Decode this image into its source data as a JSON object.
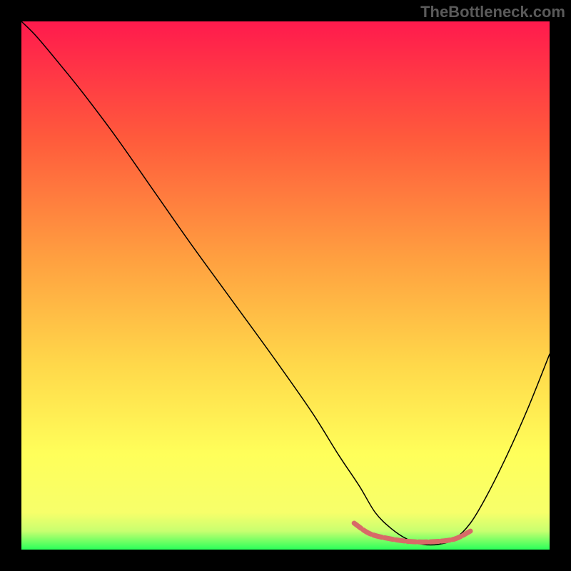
{
  "watermark": "TheBottleneck.com",
  "chart_data": {
    "type": "line",
    "title": "",
    "xlabel": "",
    "ylabel": "",
    "xlim": [
      0,
      100
    ],
    "ylim": [
      0,
      100
    ],
    "grid": false,
    "series": [
      {
        "name": "curve",
        "color": "#000000",
        "stroke_width": 1.5,
        "x": [
          0,
          3,
          8,
          12,
          18,
          25,
          32,
          40,
          48,
          55,
          60,
          64,
          67,
          70,
          73,
          76,
          79,
          82,
          85,
          88,
          92,
          96,
          100
        ],
        "y": [
          100,
          97,
          91,
          86,
          78,
          68,
          58,
          47,
          36,
          26,
          18,
          12,
          7,
          4,
          2,
          1,
          1,
          2,
          5,
          10,
          18,
          27,
          37
        ]
      },
      {
        "name": "highlight-band",
        "color": "#d86a68",
        "stroke_width": 7,
        "dash": "12,4",
        "x": [
          63,
          66,
          70,
          74,
          78,
          82,
          85
        ],
        "y": [
          5,
          3,
          2,
          1.5,
          1.5,
          2,
          3.5
        ]
      }
    ],
    "background_gradient": {
      "type": "vertical",
      "stops": [
        {
          "offset": 0.0,
          "color": "#ff1a4d"
        },
        {
          "offset": 0.22,
          "color": "#ff5a3c"
        },
        {
          "offset": 0.45,
          "color": "#ffa040"
        },
        {
          "offset": 0.65,
          "color": "#ffd84a"
        },
        {
          "offset": 0.82,
          "color": "#ffff5a"
        },
        {
          "offset": 0.93,
          "color": "#f7ff6a"
        },
        {
          "offset": 0.965,
          "color": "#c8ff70"
        },
        {
          "offset": 1.0,
          "color": "#2aff5a"
        }
      ]
    }
  }
}
